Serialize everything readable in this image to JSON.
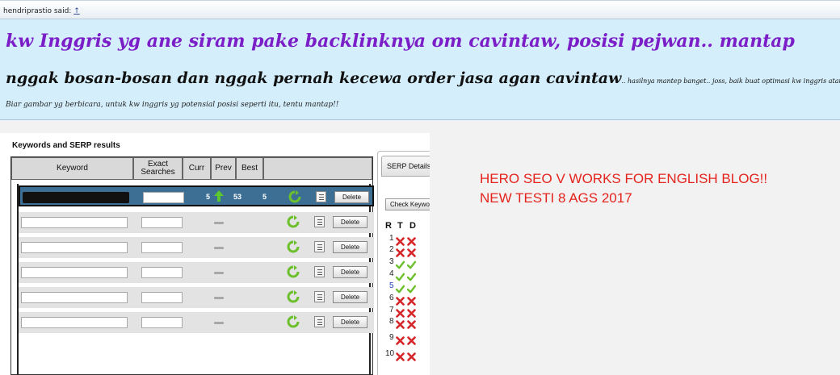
{
  "post": {
    "author": "hendriprastio said:",
    "author_link": "↑"
  },
  "quote": {
    "line1": "kw Inggris yg ane siram pake backlinknya om cavintaw, posisi pejwan.. mantap",
    "line2_big": "nggak bosan-bosan dan nggak pernah kecewa order jasa agan cavintaw",
    "line2_small": ".. hasilnya mantep banget.. joss, baik buat optimasi kw inggris atau kw indo",
    "line3": "Biar gambar yg berbicara, untuk kw inggris yg potensial posisi seperti itu, tentu mantap!!"
  },
  "tool": {
    "title": "Keywords and SERP results",
    "headers": {
      "keyword": "Keyword",
      "exact": "Exact Searches",
      "curr": "Curr",
      "prev": "Prev",
      "best": "Best"
    },
    "selected_row": {
      "curr": "5",
      "prev": "53",
      "best": "5"
    },
    "delete_label": "Delete"
  },
  "serp": {
    "tab": "SERP Details",
    "button": "Check Keyword",
    "col_r": "R",
    "col_t": "T",
    "col_d": "D",
    "rows": [
      {
        "rank": "1",
        "t": "x",
        "d": "x"
      },
      {
        "rank": "2",
        "t": "x",
        "d": "x"
      },
      {
        "rank": "3",
        "t": "check",
        "d": "check"
      },
      {
        "rank": "4",
        "t": "check",
        "d": "check"
      },
      {
        "rank": "5",
        "t": "check",
        "d": "check"
      },
      {
        "rank": "6",
        "t": "x",
        "d": "x"
      },
      {
        "rank": "7",
        "t": "x",
        "d": "x"
      },
      {
        "rank": "8",
        "t": "x",
        "d": "x"
      },
      {
        "rank": "9",
        "t": "x",
        "d": "x"
      },
      {
        "rank": "10",
        "t": "x",
        "d": "x"
      }
    ]
  },
  "annotation": {
    "line1": "HERO SEO V WORKS FOR ENGLISH BLOG!!",
    "line2": "NEW TESTI 8 AGS 2017"
  },
  "colors": {
    "headline": "#7b1ec8",
    "annotation": "#e5231d",
    "selected_row": "#3d6f95",
    "quote_bg": "#d4eefb"
  }
}
